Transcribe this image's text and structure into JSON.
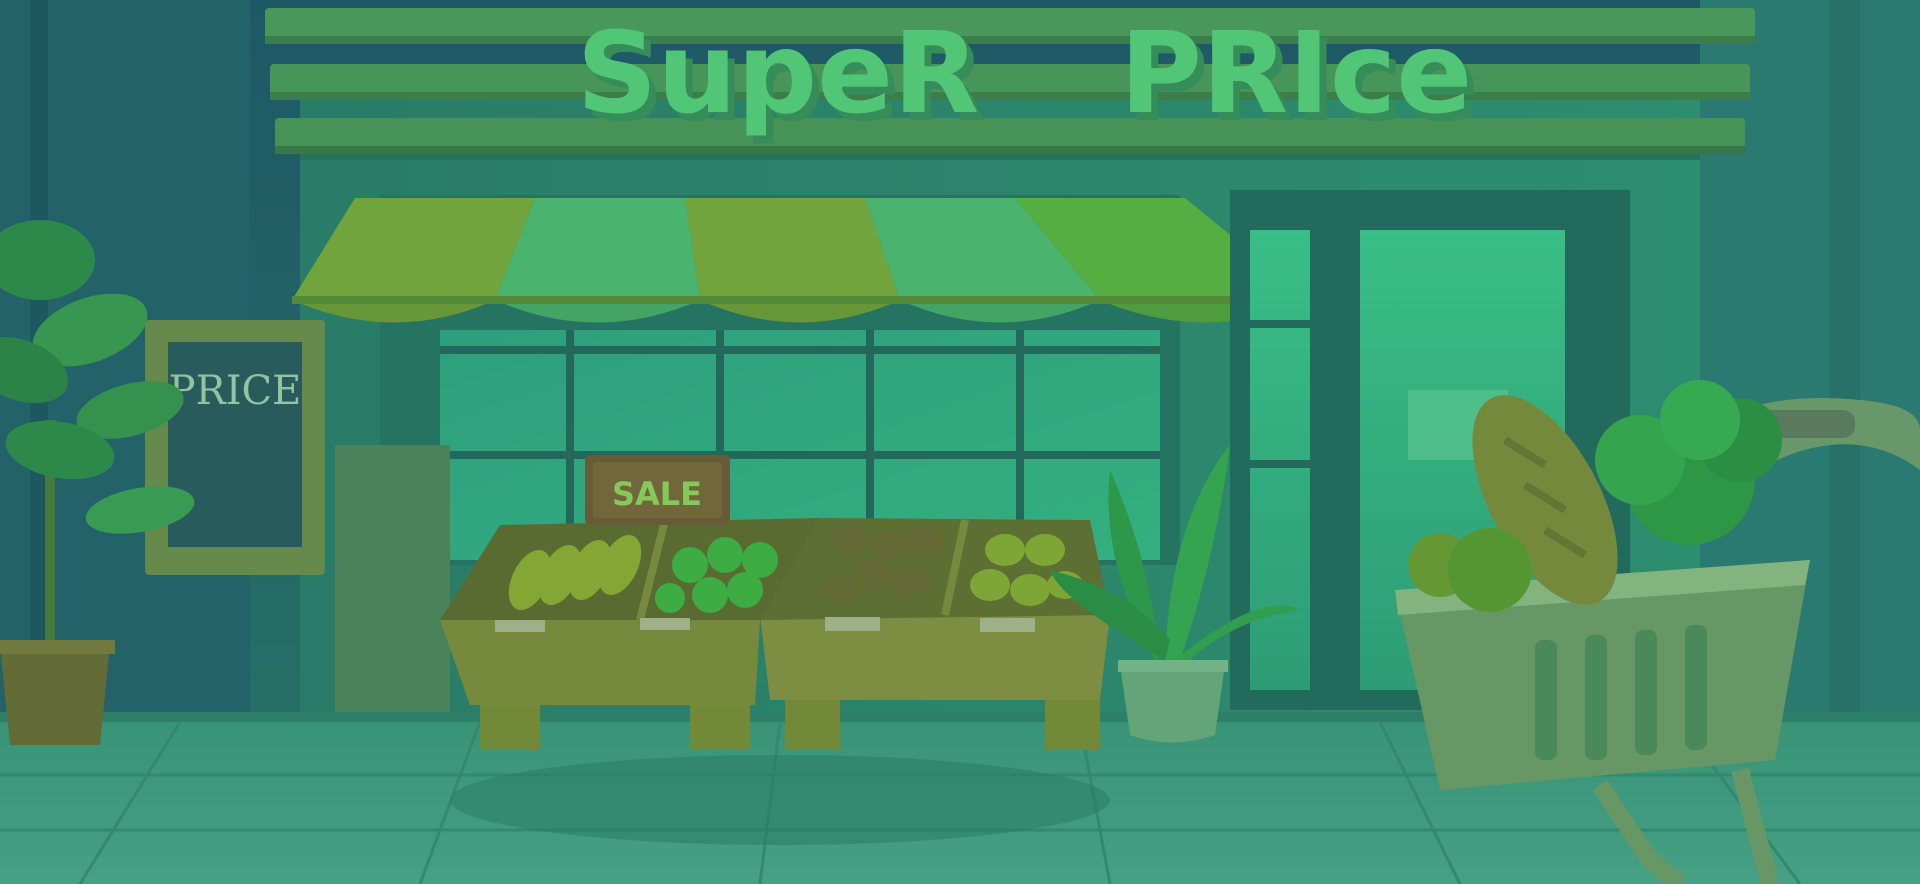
{
  "store_sign": {
    "word1": "SupeR",
    "word2": "PRIce"
  },
  "chalkboard": {
    "label": "PRICE"
  },
  "sale_sign": {
    "label": "SALE"
  },
  "colors": {
    "sky": "#1f5a5c",
    "building": "#2f8a6c",
    "sign_text": "#56cc78",
    "awning_dark": "#7aa83a",
    "awning_light": "#4fb86e",
    "wood": "#7f8a3a",
    "sale_board": "#6e5a34",
    "sale_text": "#8ed05a",
    "sidewalk": "#3f9a80"
  },
  "icons": {
    "plant_left": "potted-tree-icon",
    "plant_center": "potted-plant-icon",
    "cart": "shopping-cart-icon",
    "bread": "bread-icon",
    "lettuce": "lettuce-icon"
  }
}
